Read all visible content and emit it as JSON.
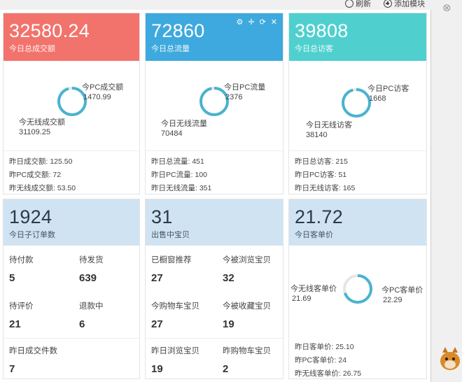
{
  "toolbar": {
    "refresh_label": "刷新",
    "add_module_label": "添加模块"
  },
  "cards": {
    "sales": {
      "value": "32580.24",
      "label": "今日总成交额",
      "pc_label": "今PC成交额",
      "pc_value": "1470.99",
      "wireless_label": "今无线成交额",
      "wireless_value": "31109.25",
      "pc_fraction": 0.045,
      "stats": [
        "昨日成交额: 125.50",
        "昨PC成交额: 72",
        "昨无线成交额: 53.50"
      ]
    },
    "traffic": {
      "value": "72860",
      "label": "今日总流量",
      "pc_label": "今日PC流量",
      "pc_value": "2376",
      "wireless_label": "今日无线流量",
      "wireless_value": "70484",
      "pc_fraction": 0.033,
      "tools": [
        "⚙",
        "✛",
        "⟳",
        "✕"
      ],
      "stats": [
        "昨日总流量: 451",
        "昨日PC流量: 100",
        "昨日无线流量: 351"
      ]
    },
    "visitors": {
      "value": "39808",
      "label": "今日总访客",
      "pc_label": "今日PC访客",
      "pc_value": "1668",
      "wireless_label": "今日无线访客",
      "wireless_value": "38140",
      "pc_fraction": 0.042,
      "stats": [
        "昨日总访客: 215",
        "昨日PC访客: 51",
        "昨日无线访客: 165"
      ]
    },
    "orders": {
      "value": "1924",
      "label": "今日子订单数",
      "cells": [
        {
          "k": "待付款",
          "v": "5"
        },
        {
          "k": "待发货",
          "v": "639"
        },
        {
          "k": "待评价",
          "v": "21"
        },
        {
          "k": "退款中",
          "v": "6"
        },
        {
          "k": "昨日成交件数",
          "v": "7"
        }
      ]
    },
    "items": {
      "value": "31",
      "label": "出售中宝贝",
      "cells": [
        {
          "k": "已橱窗推荐",
          "v": "27"
        },
        {
          "k": "今被浏览宝贝",
          "v": "32"
        },
        {
          "k": "今购物车宝贝",
          "v": "27"
        },
        {
          "k": "今被收藏宝贝",
          "v": "19"
        },
        {
          "k": "昨日浏览宝贝",
          "v": "19"
        },
        {
          "k": "昨购物车宝贝",
          "v": "2"
        }
      ]
    },
    "aov": {
      "value": "21.72",
      "label": "今日客单价",
      "wireless_label": "今无线客单价",
      "wireless_value": "21.69",
      "pc_label": "今PC客单价",
      "pc_value": "22.29",
      "pc_fraction": 0.3,
      "stats": [
        "昨日客单价: 25.10",
        "昨PC客单价: 24",
        "昨无线客单价: 26.75"
      ]
    }
  },
  "colors": {
    "red": "#f2736c",
    "blue": "#3ea9de",
    "teal": "#4fd0cf",
    "pale": "#cfe3f3",
    "ring": "#4ab3cf"
  }
}
